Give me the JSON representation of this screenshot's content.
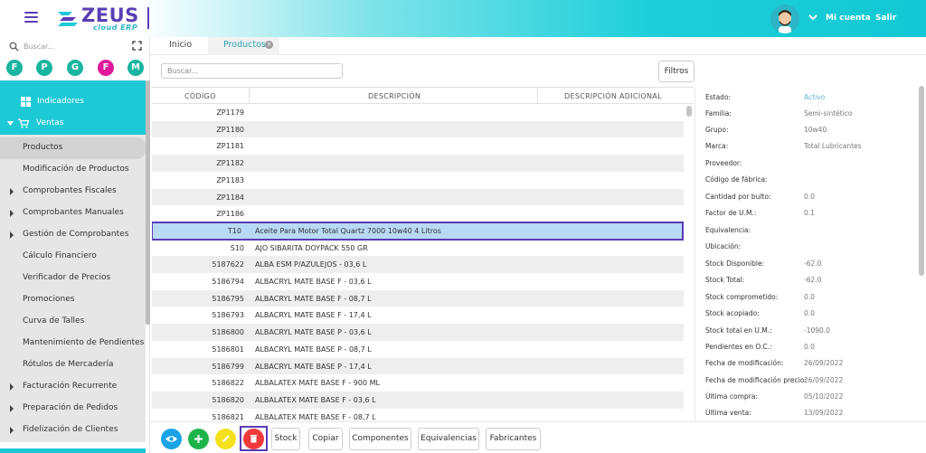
{
  "header": {
    "logo_text": "ZEUS",
    "logo_sub": "cloud ERP",
    "account_label": "Mi cuenta",
    "logout_label": "Salir",
    "icons": {
      "menu": "hamburger-icon",
      "avatar": "user-avatar",
      "chevron": "chevron-down-icon"
    },
    "colors": {
      "brand": "#5b3bb7",
      "accent": "#1dc9d5"
    }
  },
  "sidebar": {
    "search_placeholder": "Buscar...",
    "quick_links": [
      {
        "letter": "F",
        "color": "#1ab5a0"
      },
      {
        "letter": "P",
        "color": "#1ab5a0"
      },
      {
        "letter": "G",
        "color": "#1ab5a0"
      },
      {
        "letter": "F",
        "color": "#e0189b"
      },
      {
        "letter": "M",
        "color": "#1ab5a0"
      }
    ],
    "items": [
      {
        "label": "Indicadores"
      },
      {
        "label": "Ventas"
      },
      {
        "label": "Productos"
      },
      {
        "label": "Modificación de Productos"
      },
      {
        "label": "Comprobantes Fiscales"
      },
      {
        "label": "Comprobantes Manuales"
      },
      {
        "label": "Gestión de Comprobantes"
      },
      {
        "label": "Cálculo Financiero"
      },
      {
        "label": "Verificador de Precios"
      },
      {
        "label": "Promociones"
      },
      {
        "label": "Curva de Talles"
      },
      {
        "label": "Mantenimiento de Pendientes"
      },
      {
        "label": "Rótulos de Mercadería"
      },
      {
        "label": "Facturación Recurrente"
      },
      {
        "label": "Preparación de Pedidos"
      },
      {
        "label": "Fidelización de Clientes"
      }
    ]
  },
  "tabs": [
    {
      "label": "Inicio"
    },
    {
      "label": "Productos"
    }
  ],
  "main": {
    "search_placeholder": "Buscar...",
    "filters_label": "Filtros",
    "columns": [
      "CÓDIGO",
      "DESCRIPCIÓN",
      "DESCRIPCIÓN ADICIONAL"
    ],
    "rows": [
      {
        "code": "ZP1179",
        "desc": ""
      },
      {
        "code": "ZP1180",
        "desc": ""
      },
      {
        "code": "ZP1181",
        "desc": ""
      },
      {
        "code": "ZP1182",
        "desc": ""
      },
      {
        "code": "ZP1183",
        "desc": ""
      },
      {
        "code": "ZP1184",
        "desc": ""
      },
      {
        "code": "ZP1186",
        "desc": ""
      },
      {
        "code": "T10",
        "desc": "Aceite Para Motor Total Quartz 7000 10w40 4 Litros"
      },
      {
        "code": "S10",
        "desc": "AJO SIBARITA DOYPACK 550 GR"
      },
      {
        "code": "5187622",
        "desc": "ALBA ESM P/AZULEJOS - 03,6 L"
      },
      {
        "code": "5186794",
        "desc": "ALBACRYL MATE BASE F - 03,6 L"
      },
      {
        "code": "5186795",
        "desc": "ALBACRYL MATE BASE F - 08,7 L"
      },
      {
        "code": "5186793",
        "desc": "ALBACRYL MATE BASE F - 17,4 L"
      },
      {
        "code": "5186800",
        "desc": "ALBACRYL MATE BASE P - 03,6 L"
      },
      {
        "code": "5186801",
        "desc": "ALBACRYL MATE BASE P - 08,7 L"
      },
      {
        "code": "5186799",
        "desc": "ALBACRYL MATE BASE P - 17,4 L"
      },
      {
        "code": "5186822",
        "desc": "ALBALATEX MATE BASE F - 900 ML"
      },
      {
        "code": "5186820",
        "desc": "ALBALATEX MATE BASE F - 03,6 L"
      },
      {
        "code": "5186821",
        "desc": "ALBALATEX MATE BASE F - 08,7 L"
      }
    ]
  },
  "details": [
    {
      "label": "Estado:",
      "value": "Activo"
    },
    {
      "label": "Familia:",
      "value": "Semi-sintético"
    },
    {
      "label": "Grupo:",
      "value": "10w40"
    },
    {
      "label": "Marca:",
      "value": "Total Lubricantes"
    },
    {
      "label": "Proveedor:",
      "value": ""
    },
    {
      "label": "Código de fábrica:",
      "value": ""
    },
    {
      "label": "Cantidad por bulto:",
      "value": "0.0"
    },
    {
      "label": "Factor de U.M.:",
      "value": "0.1"
    },
    {
      "label": "Equivalencia:",
      "value": ""
    },
    {
      "label": "Ubicación:",
      "value": ""
    },
    {
      "label": "Stock Disponible:",
      "value": "-62.0"
    },
    {
      "label": "Stock Total:",
      "value": "-62.0"
    },
    {
      "label": "Stock comprometido:",
      "value": "0.0"
    },
    {
      "label": "Stock acopiado:",
      "value": "0.0"
    },
    {
      "label": "Stock total en U.M.:",
      "value": "-1090.0"
    },
    {
      "label": "Pendientes en O.C.:",
      "value": "0.0"
    },
    {
      "label": "Fecha de modificación:",
      "value": "26/09/2022"
    },
    {
      "label": "Fecha de modificación precio:",
      "value": "26/09/2022"
    },
    {
      "label": "Última compra:",
      "value": "05/10/2022"
    },
    {
      "label": "Última venta:",
      "value": "13/09/2022"
    }
  ],
  "toolbar": {
    "stock": "Stock",
    "copy": "Copiar",
    "components": "Componentes",
    "equivalences": "Equivalencias",
    "manufacturers": "Fabricantes",
    "icon_buttons": [
      {
        "icon": "eye-icon",
        "color": "#1aa3e6"
      },
      {
        "icon": "plus-icon",
        "color": "#1db34a"
      },
      {
        "icon": "pencil-icon",
        "color": "#f4e01c"
      },
      {
        "icon": "trash-icon",
        "color": "#f03a3a"
      }
    ]
  }
}
